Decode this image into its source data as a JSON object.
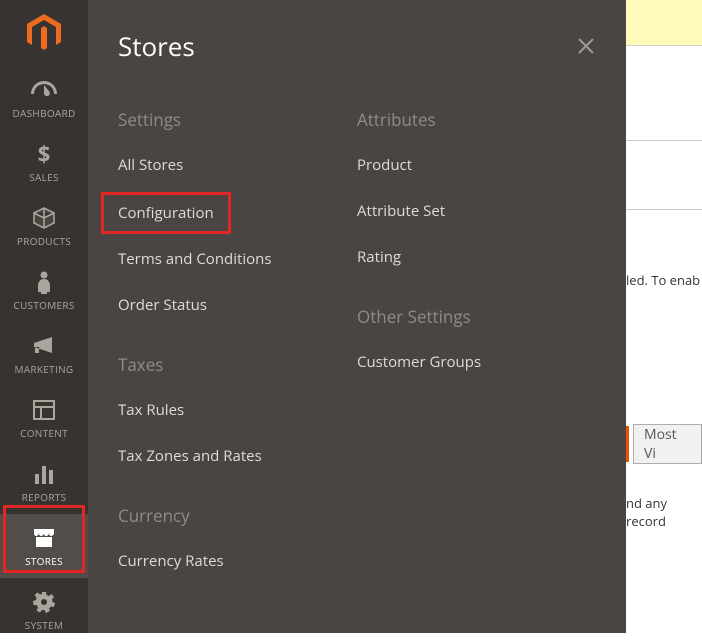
{
  "sidebar": {
    "items": [
      {
        "label": "DASHBOARD",
        "name": "dashboard"
      },
      {
        "label": "SALES",
        "name": "sales"
      },
      {
        "label": "PRODUCTS",
        "name": "products"
      },
      {
        "label": "CUSTOMERS",
        "name": "customers"
      },
      {
        "label": "MARKETING",
        "name": "marketing"
      },
      {
        "label": "CONTENT",
        "name": "content"
      },
      {
        "label": "REPORTS",
        "name": "reports"
      },
      {
        "label": "STORES",
        "name": "stores"
      },
      {
        "label": "SYSTEM",
        "name": "system"
      }
    ]
  },
  "flyout": {
    "title": "Stores",
    "groups": {
      "settings": {
        "title": "Settings",
        "items": [
          "All Stores",
          "Configuration",
          "Terms and Conditions",
          "Order Status"
        ]
      },
      "taxes": {
        "title": "Taxes",
        "items": [
          "Tax Rules",
          "Tax Zones and Rates"
        ]
      },
      "currency": {
        "title": "Currency",
        "items": [
          "Currency Rates"
        ]
      },
      "attributes": {
        "title": "Attributes",
        "items": [
          "Product",
          "Attribute Set",
          "Rating"
        ]
      },
      "other": {
        "title": "Other Settings",
        "items": [
          "Customer Groups"
        ]
      }
    }
  },
  "background": {
    "partial1": "led. To enab",
    "tab_label": "Most Vi",
    "partial2": "nd any record"
  },
  "colors": {
    "highlight": "#e22626",
    "sidebar_bg": "#373330",
    "flyout_bg": "#4a4542",
    "accent": "#eb5202"
  }
}
